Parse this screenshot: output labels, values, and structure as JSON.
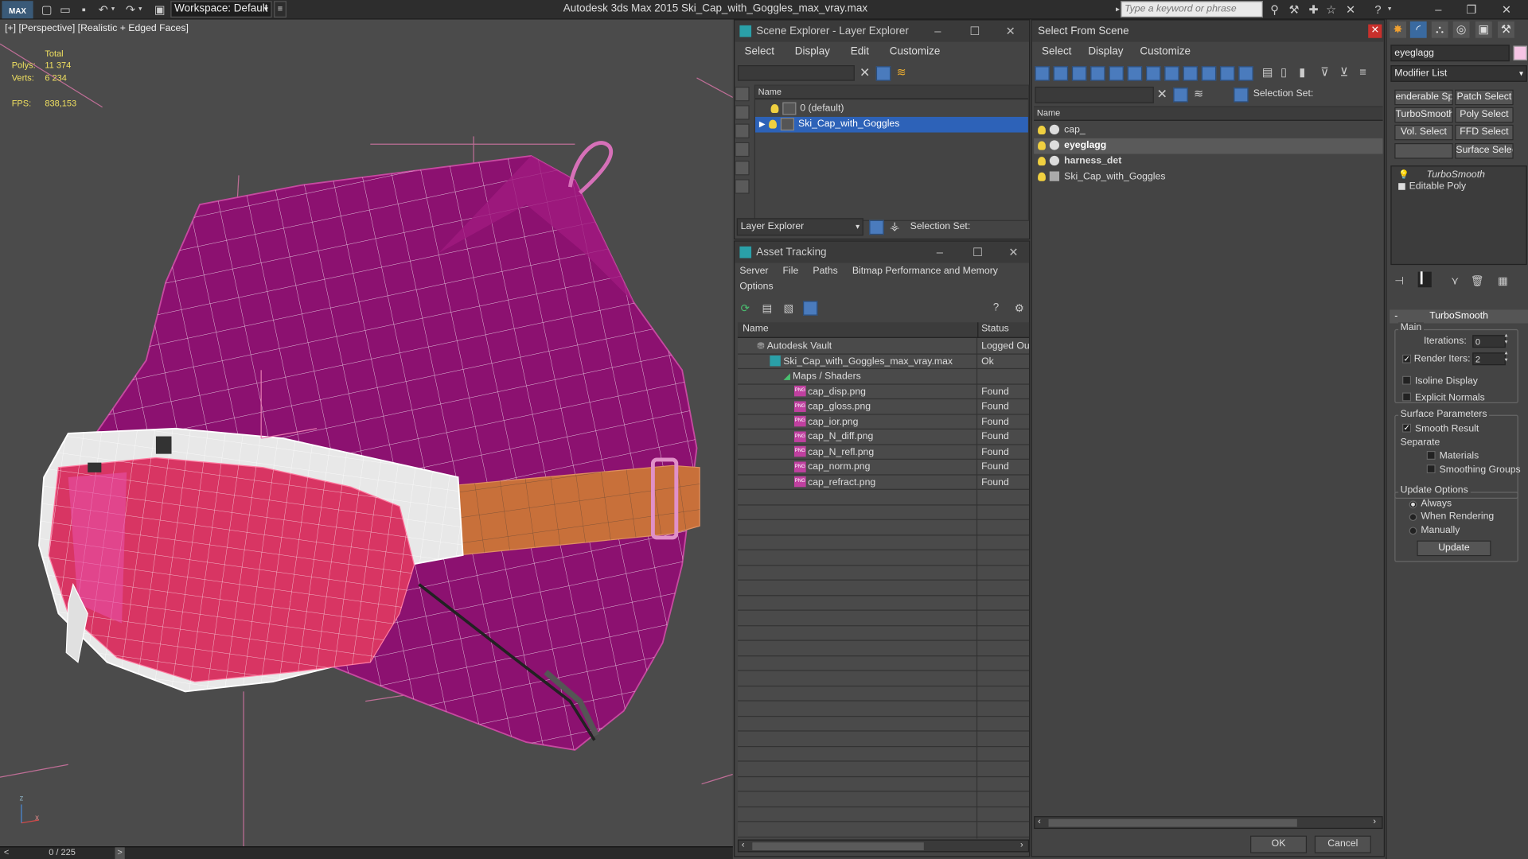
{
  "titlebar": {
    "logo": "MAX",
    "workspace": "Workspace: Default",
    "app_title": "Autodesk 3ds Max  2015     Ski_Cap_with_Goggles_max_vray.max",
    "search_placeholder": "Type a keyword or phrase"
  },
  "viewport": {
    "label": "[+] [Perspective] [Realistic + Edged Faces]",
    "stats": {
      "total_label": "Total",
      "polys_label": "Polys:",
      "polys_value": "11 374",
      "verts_label": "Verts:",
      "verts_value": "6 234",
      "fps_label": "FPS:",
      "fps_value": "838,153"
    },
    "axis_z": "z",
    "axis_x": "x",
    "timeline": "0 / 225",
    "timeline_prev": "<",
    "timeline_next": ">",
    "colors": {
      "cap": "#8c1170",
      "goggles_lens": "#d83563",
      "strap": "#c8703a",
      "frame": "#e0e0e0",
      "background": "#4b4b4b"
    }
  },
  "scene_explorer": {
    "title": "Scene Explorer - Layer Explorer",
    "menu": [
      "Select",
      "Display",
      "Edit",
      "Customize"
    ],
    "col_name": "Name",
    "rows": [
      "0 (default)",
      "Ski_Cap_with_Goggles"
    ],
    "footer_dropdown": "Layer Explorer",
    "selection_set": "Selection Set:"
  },
  "asset_tracking": {
    "title": "Asset Tracking",
    "menu1": [
      "Server",
      "File",
      "Paths",
      "Bitmap Performance and Memory"
    ],
    "menu2": "Options",
    "col_name": "Name",
    "col_status": "Status",
    "rows": [
      {
        "name": "Autodesk Vault",
        "status": "Logged Ou"
      },
      {
        "name": "Ski_Cap_with_Goggles_max_vray.max",
        "status": "Ok"
      },
      {
        "name": "Maps / Shaders",
        "status": ""
      },
      {
        "name": "cap_disp.png",
        "status": "Found"
      },
      {
        "name": "cap_gloss.png",
        "status": "Found"
      },
      {
        "name": "cap_ior.png",
        "status": "Found"
      },
      {
        "name": "cap_N_diff.png",
        "status": "Found"
      },
      {
        "name": "cap_N_refl.png",
        "status": "Found"
      },
      {
        "name": "cap_norm.png",
        "status": "Found"
      },
      {
        "name": "cap_refract.png",
        "status": "Found"
      }
    ],
    "png_badge": "PNG"
  },
  "select_from_scene": {
    "title": "Select From Scene",
    "menu": [
      "Select",
      "Display",
      "Customize"
    ],
    "selection_set": "Selection Set:",
    "col_name": "Name",
    "rows": [
      "cap_",
      "eyeglagg",
      "harness_det",
      "Ski_Cap_with_Goggles"
    ],
    "ok": "OK",
    "cancel": "Cancel"
  },
  "command_panel": {
    "object_name": "eyeglagg",
    "modifier_list": "Modifier List",
    "buttons": [
      "enderable Spli",
      "Patch Select",
      "TurboSmooth",
      "Poly Select",
      "Vol. Select",
      "FFD Select",
      "",
      "Surface Select"
    ],
    "stack": [
      "TurboSmooth",
      "Editable Poly"
    ],
    "rollout_title": "TurboSmooth",
    "main_label": "Main",
    "iterations_label": "Iterations:",
    "iterations_value": "0",
    "render_iters_label": "Render Iters:",
    "render_iters_value": "2",
    "isoline_label": "Isoline Display",
    "explicit_normals_label": "Explicit Normals",
    "surface_params_label": "Surface Parameters",
    "smooth_result_label": "Smooth Result",
    "separate_label": "Separate",
    "materials_label": "Materials",
    "smoothing_groups_label": "Smoothing Groups",
    "update_options_label": "Update Options",
    "always_label": "Always",
    "when_rendering_label": "When Rendering",
    "manually_label": "Manually",
    "update_button": "Update"
  }
}
